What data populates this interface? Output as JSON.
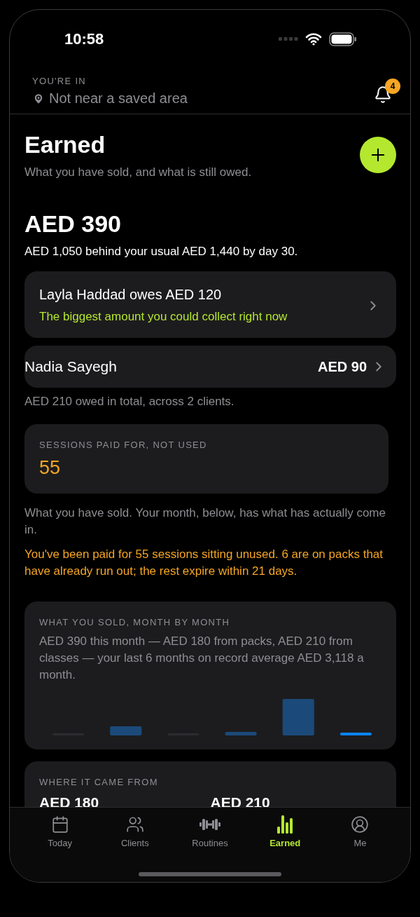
{
  "status_bar": {
    "time": "10:58"
  },
  "header": {
    "label": "YOU'RE IN",
    "location": "Not near a saved area",
    "notification_count": "4"
  },
  "page": {
    "title": "Earned",
    "subtitle": "What you have sold, and what is still owed."
  },
  "total": {
    "amount": "AED 390",
    "note": "AED 1,050 behind your usual AED 1,440 by day 30."
  },
  "owed": [
    {
      "kind": "highlight",
      "title": "Layla Haddad owes AED 120",
      "subtitle": "The biggest amount you could collect right now"
    },
    {
      "kind": "plain",
      "name": "Nadia Sayegh",
      "amount": "AED 90"
    }
  ],
  "owed_summary": "AED 210 owed in total, across 2 clients.",
  "sessions": {
    "label": "SESSIONS PAID FOR, NOT USED",
    "value": "55"
  },
  "sold_note": "What you have sold. Your month, below, has what has actually come in.",
  "warning": "You've been paid for 55 sessions sitting unused. 6 are on packs that have already run out; the rest expire within 21 days.",
  "monthly": {
    "label": "WHAT YOU SOLD, MONTH BY MONTH",
    "summary": "AED 390 this month — AED 180 from packs, AED 210 from classes — your last 6 months on record average AED 3,118 a month."
  },
  "sources": {
    "label": "WHERE IT CAME FROM",
    "amounts": [
      "AED 180",
      "AED 210"
    ]
  },
  "tabs": [
    {
      "label": "Today",
      "selected": false
    },
    {
      "label": "Clients",
      "selected": false
    },
    {
      "label": "Routines",
      "selected": false
    },
    {
      "label": "Earned",
      "selected": true
    },
    {
      "label": "Me",
      "selected": false
    }
  ]
}
